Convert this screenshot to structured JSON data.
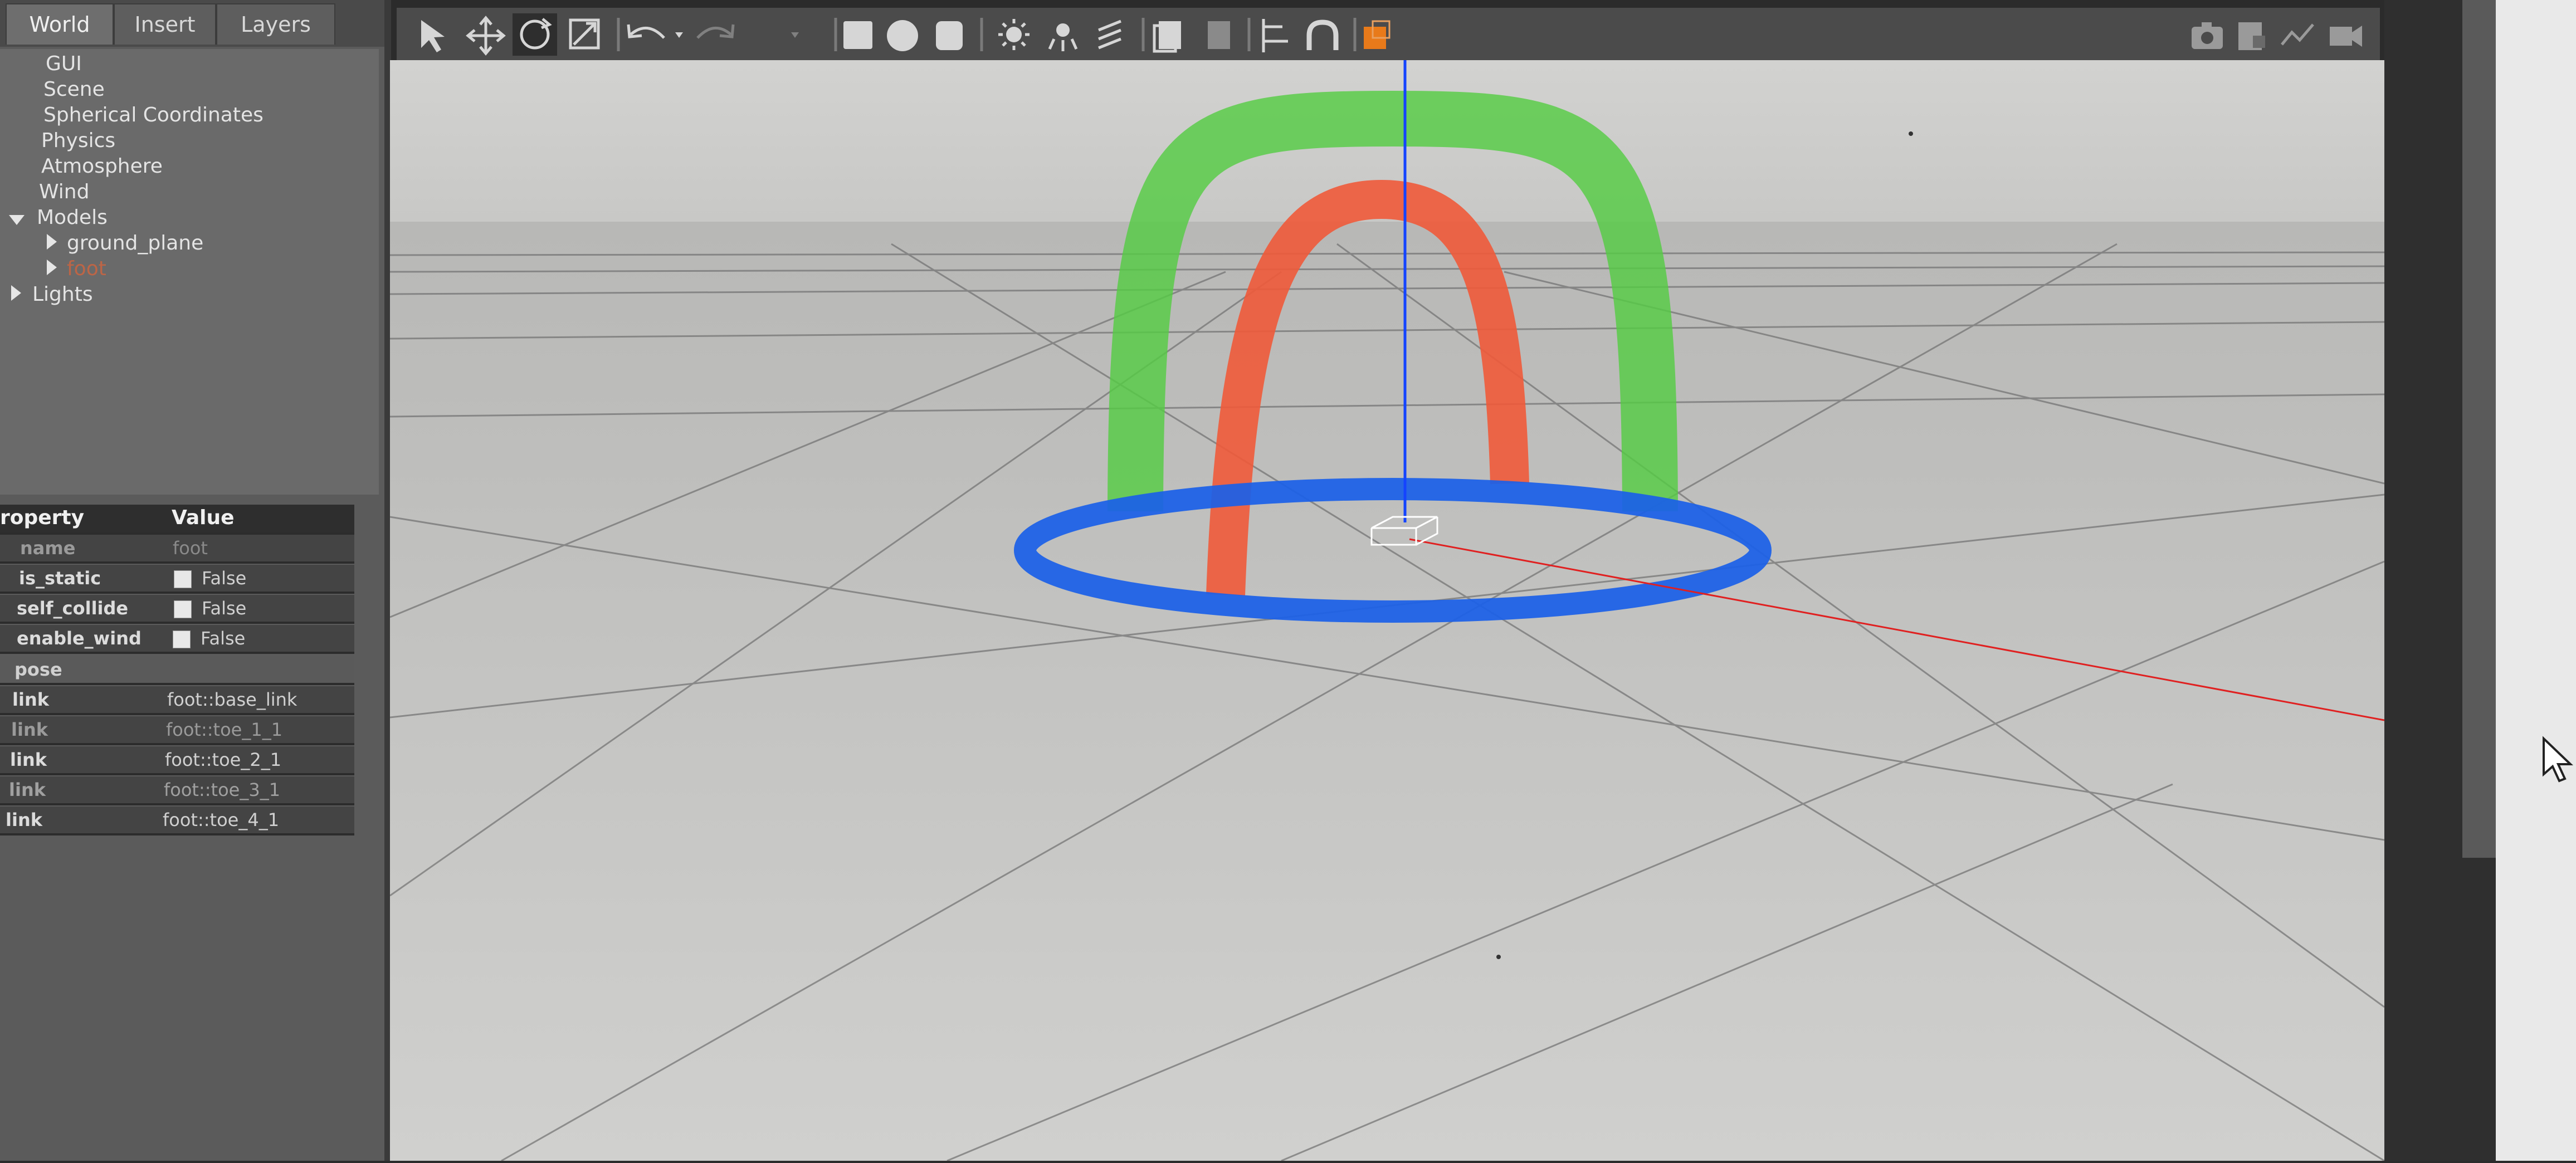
{
  "tabs": [
    {
      "label": "World",
      "active": true
    },
    {
      "label": "Insert",
      "active": false
    },
    {
      "label": "Layers",
      "active": false
    }
  ],
  "tree": {
    "items": [
      "GUI",
      "Scene",
      "Spherical Coordinates",
      "Physics",
      "Atmosphere",
      "Wind"
    ],
    "models_label": "Models",
    "model_children": [
      "ground_plane",
      "foot"
    ],
    "lights_label": "Lights",
    "selected_color": "#d9643a"
  },
  "properties": {
    "header_property": "roperty",
    "header_value": "Value",
    "rows": [
      {
        "key": "name",
        "value": "foot",
        "checkbox": false
      },
      {
        "key": "is_static",
        "value": "False",
        "checkbox": true
      },
      {
        "key": "self_collide",
        "value": "False",
        "checkbox": true
      },
      {
        "key": "enable_wind",
        "value": "False",
        "checkbox": true
      },
      {
        "key": "pose",
        "value": "",
        "checkbox": false
      },
      {
        "key": "link",
        "value": "foot::base_link",
        "checkbox": false
      },
      {
        "key": "link",
        "value": "foot::toe_1_1",
        "checkbox": false
      },
      {
        "key": "link",
        "value": "foot::toe_2_1",
        "checkbox": false
      },
      {
        "key": "link",
        "value": "foot::toe_3_1",
        "checkbox": false
      },
      {
        "key": "link",
        "value": "foot::toe_4_1",
        "checkbox": false
      }
    ]
  },
  "toolbar": {
    "icons": [
      "select-arrow-icon",
      "translate-icon",
      "rotate-icon",
      "scale-icon",
      "undo-icon",
      "undo-dropdown-icon",
      "redo-icon",
      "redo-dropdown-icon",
      "box-shape-icon",
      "sphere-shape-icon",
      "cylinder-shape-icon",
      "point-light-icon",
      "spot-light-icon",
      "directional-light-icon",
      "copy-icon",
      "paste-icon",
      "align-icon",
      "snap-icon",
      "view-angle-icon"
    ],
    "right_icons": [
      "screenshot-icon",
      "log-icon",
      "plot-icon",
      "video-record-icon"
    ]
  },
  "scene": {
    "ring_colors": {
      "green": "#55cc44",
      "red": "#f05a3a",
      "blue": "#1a5fe8"
    },
    "axis_colors": {
      "z": "#1444ff",
      "x": "#e02020"
    }
  }
}
